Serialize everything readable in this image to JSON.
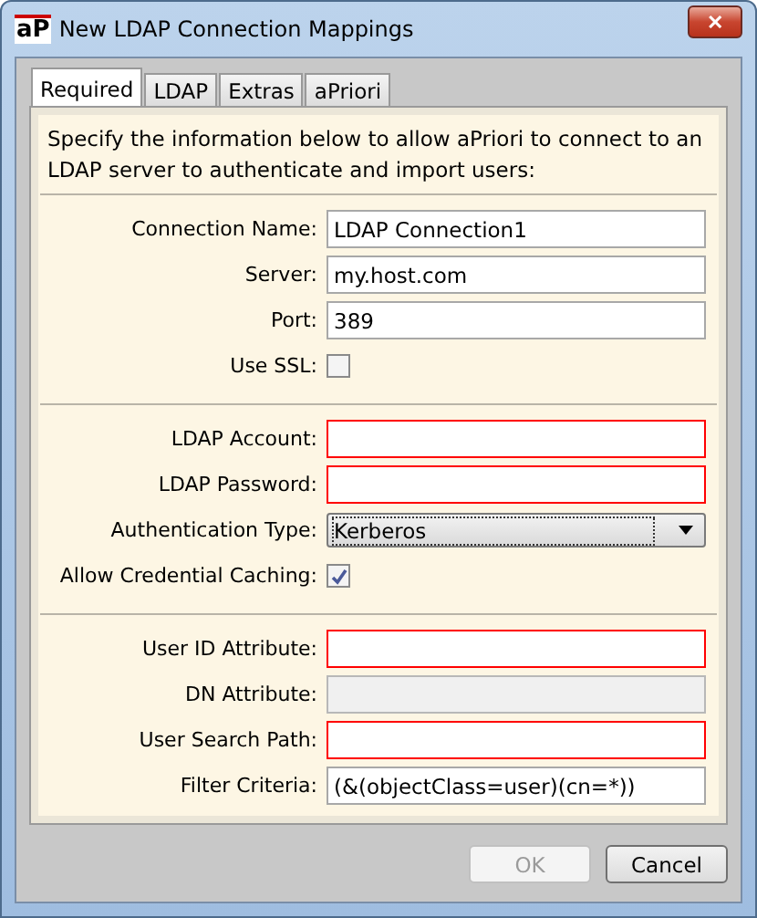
{
  "window": {
    "title": "New LDAP Connection Mappings",
    "logo": "aP",
    "close": "✕"
  },
  "tabs": [
    {
      "label": "Required",
      "selected": true
    },
    {
      "label": "LDAP",
      "selected": false
    },
    {
      "label": "Extras",
      "selected": false
    },
    {
      "label": "aPriori",
      "selected": false
    }
  ],
  "intro": "Specify the information below to allow aPriori to connect to an LDAP server to authenticate and import users:",
  "groups": [
    {
      "fields": [
        {
          "kind": "text",
          "label": "Connection Name:",
          "value": "LDAP Connection1",
          "required": false,
          "disabled": false
        },
        {
          "kind": "text",
          "label": "Server:",
          "value": "my.host.com",
          "required": false,
          "disabled": false
        },
        {
          "kind": "text",
          "label": "Port:",
          "value": "389",
          "required": false,
          "disabled": false
        },
        {
          "kind": "checkbox",
          "label": "Use SSL:",
          "checked": false
        }
      ]
    },
    {
      "fields": [
        {
          "kind": "text",
          "label": "LDAP Account:",
          "required": true,
          "disabled": false
        },
        {
          "kind": "password",
          "label": "LDAP Password:",
          "required": true,
          "disabled": false
        },
        {
          "kind": "select",
          "label": "Authentication Type:",
          "value": "Kerberos"
        },
        {
          "kind": "checkbox",
          "label": "Allow Credential Caching:",
          "checked": true
        }
      ]
    },
    {
      "fields": [
        {
          "kind": "text",
          "label": "User ID Attribute:",
          "required": true,
          "disabled": false
        },
        {
          "kind": "text",
          "label": "DN Attribute:",
          "required": false,
          "disabled": true
        },
        {
          "kind": "text",
          "label": "User Search Path:",
          "required": true,
          "disabled": false
        },
        {
          "kind": "text",
          "label": "Filter Criteria:",
          "value": "(&(objectClass=user)(cn=*))",
          "required": false,
          "disabled": false
        }
      ]
    }
  ],
  "buttons": [
    {
      "label": "OK",
      "disabled": true
    },
    {
      "label": "Cancel",
      "disabled": false
    }
  ]
}
